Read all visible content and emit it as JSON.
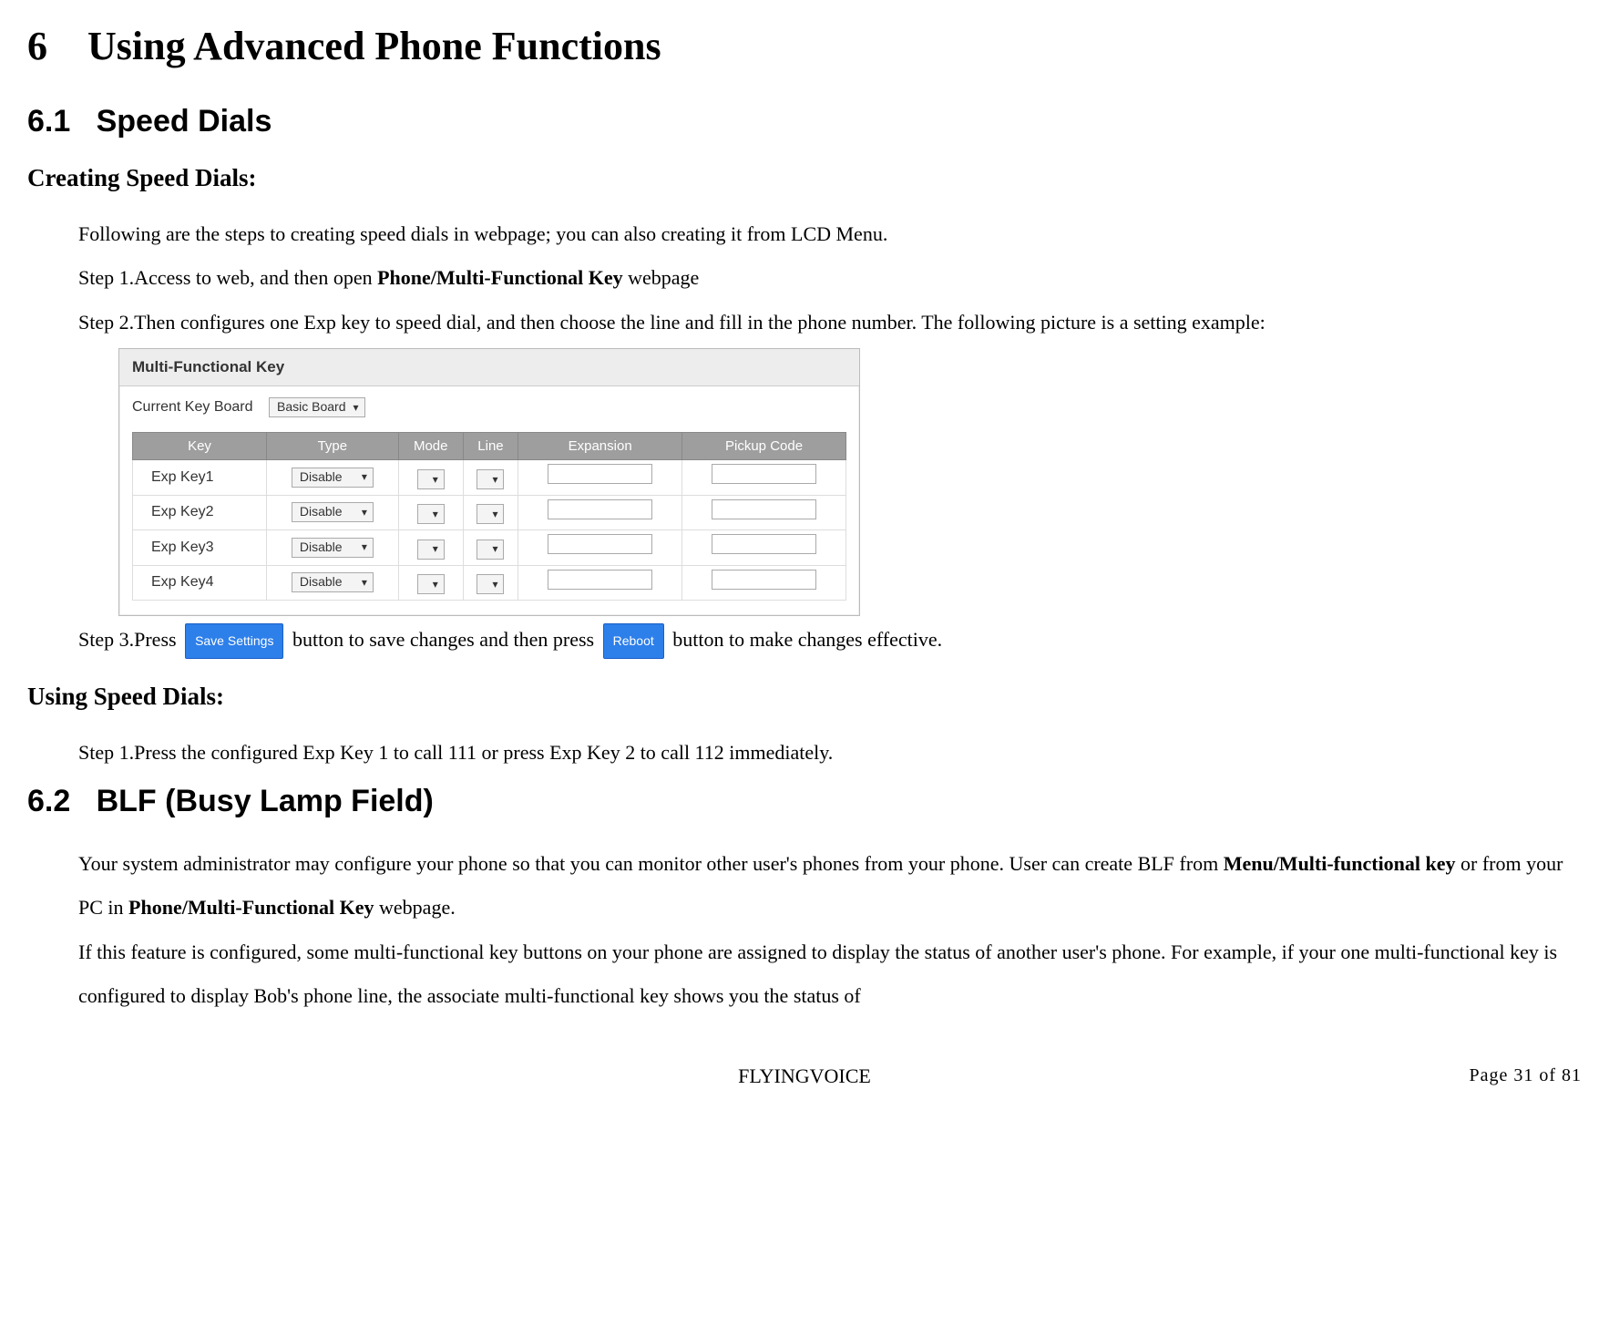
{
  "chapter": {
    "number": "6",
    "title": "Using Advanced Phone Functions"
  },
  "section61": {
    "number": "6.1",
    "title": "Speed Dials"
  },
  "creating": {
    "heading": "Creating Speed Dials:",
    "intro": "Following are the steps to creating speed dials in webpage; you can also creating it from LCD Menu.",
    "step1_pre": "Step 1.Access to web, and then open ",
    "step1_bold": "Phone/Multi-Functional Key",
    "step1_post": " webpage",
    "step2": "Step 2.Then configures one Exp key to speed dial, and then choose the line and fill in the phone number. The following picture is a setting example:",
    "step3_pre": "Step 3.Press ",
    "step3_mid": " button to save changes and then press ",
    "step3_post": " button to make changes effective."
  },
  "buttons": {
    "save": "Save Settings",
    "reboot": "Reboot"
  },
  "mfk": {
    "panel_title": "Multi-Functional Key",
    "board_label": "Current Key Board",
    "board_value": "Basic Board",
    "columns": [
      "Key",
      "Type",
      "Mode",
      "Line",
      "Expansion",
      "Pickup Code"
    ],
    "rows": [
      {
        "key": "Exp Key1",
        "type": "Disable"
      },
      {
        "key": "Exp Key2",
        "type": "Disable"
      },
      {
        "key": "Exp Key3",
        "type": "Disable"
      },
      {
        "key": "Exp Key4",
        "type": "Disable"
      }
    ]
  },
  "using": {
    "heading": "Using Speed Dials:",
    "step1": "Step 1.Press the configured Exp Key 1 to call 111 or press Exp Key 2 to call 112 immediately."
  },
  "section62": {
    "number": "6.2",
    "title": "BLF (Busy Lamp Field)",
    "p1_pre": "Your system administrator may configure your phone so that you can monitor other user's phones from your phone. User can create BLF from ",
    "p1_bold1": "Menu/Multi-functional key",
    "p1_mid": " or from your PC in ",
    "p1_bold2": "Phone/Multi-Functional Key",
    "p1_post": " webpage.",
    "p2": "If this feature is configured, some multi-functional key buttons on your phone are assigned to display the status of another user's phone. For example, if your one multi-functional key is configured to display Bob's phone line, the associate multi-functional key shows you the status of"
  },
  "footer": {
    "center": "FLYINGVOICE",
    "right": "Page 31 of 81"
  }
}
